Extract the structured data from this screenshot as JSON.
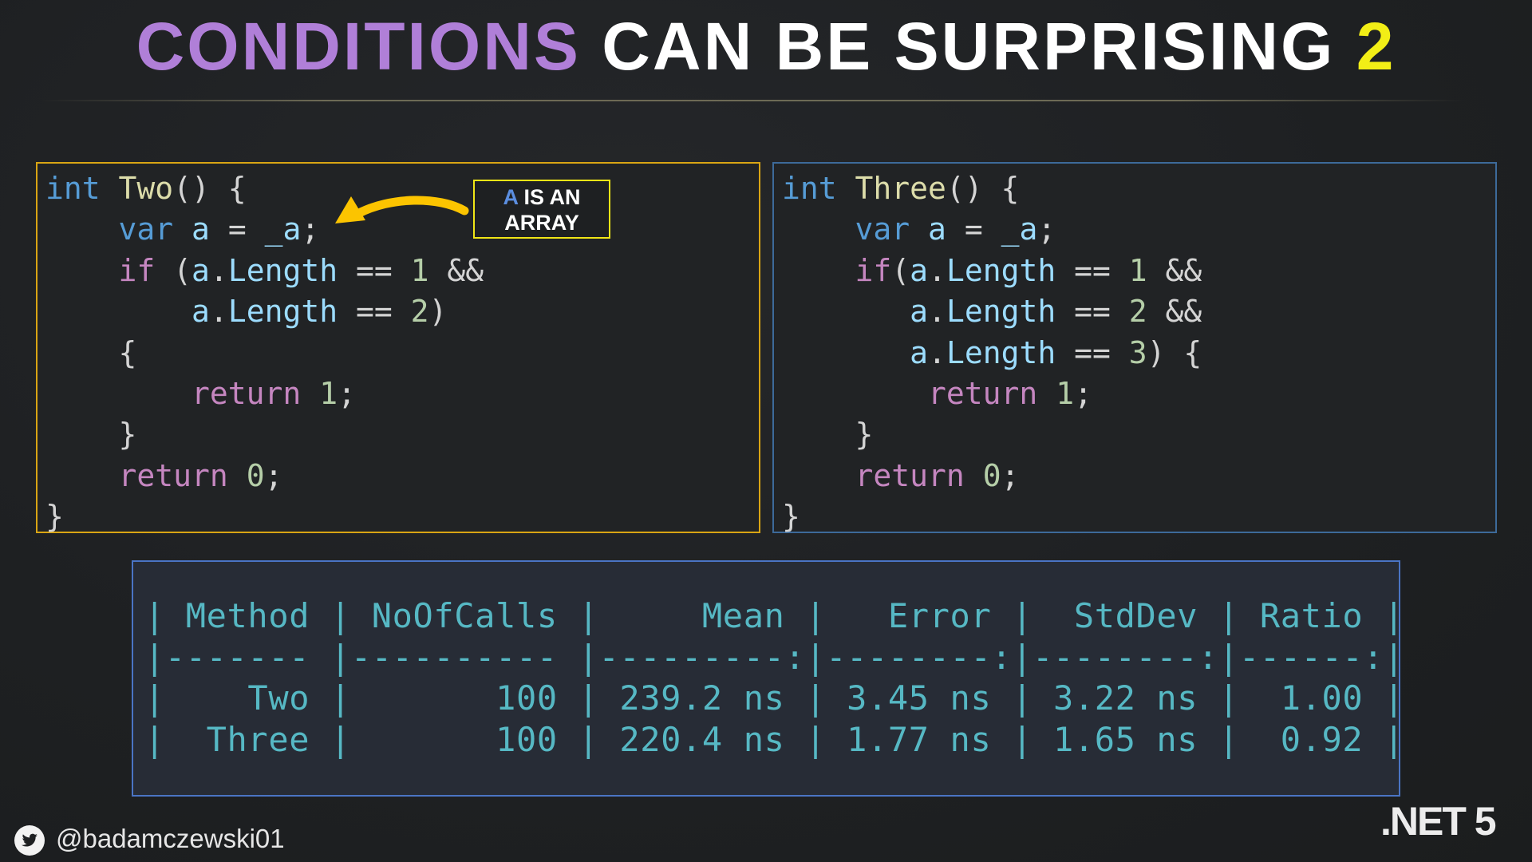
{
  "title": {
    "part1": "CONDITIONS",
    "part2": "CAN BE SURPRISING",
    "part3": "2",
    "colors": {
      "part1": "#b07fd8",
      "part2": "#ffffff",
      "part3": "#f2ee16"
    }
  },
  "code_colors": {
    "kw": "#569cd6",
    "fn": "#dcdcaa",
    "ctl": "#c586c0",
    "id": "#9cdcfe",
    "num": "#b5cea8",
    "p": "#d4d4d4"
  },
  "left_code": [
    [
      [
        "kw",
        "int"
      ],
      [
        "p",
        " "
      ],
      [
        "fn",
        "Two"
      ],
      [
        "p",
        "() {"
      ]
    ],
    [
      [
        "p",
        "    "
      ],
      [
        "kw",
        "var"
      ],
      [
        "p",
        " "
      ],
      [
        "id",
        "a"
      ],
      [
        "p",
        " = "
      ],
      [
        "id",
        "_a"
      ],
      [
        "p",
        ";"
      ]
    ],
    [
      [
        "p",
        "    "
      ],
      [
        "ctl",
        "if"
      ],
      [
        "p",
        " ("
      ],
      [
        "id",
        "a"
      ],
      [
        "p",
        "."
      ],
      [
        "id",
        "Length"
      ],
      [
        "p",
        " == "
      ],
      [
        "num",
        "1"
      ],
      [
        "p",
        " &&"
      ]
    ],
    [
      [
        "p",
        "        "
      ],
      [
        "id",
        "a"
      ],
      [
        "p",
        "."
      ],
      [
        "id",
        "Length"
      ],
      [
        "p",
        " == "
      ],
      [
        "num",
        "2"
      ],
      [
        "p",
        ")"
      ]
    ],
    [
      [
        "p",
        "    {"
      ]
    ],
    [
      [
        "p",
        "        "
      ],
      [
        "ctl",
        "return"
      ],
      [
        "p",
        " "
      ],
      [
        "num",
        "1"
      ],
      [
        "p",
        ";"
      ]
    ],
    [
      [
        "p",
        "    }"
      ]
    ],
    [
      [
        "p",
        "    "
      ],
      [
        "ctl",
        "return"
      ],
      [
        "p",
        " "
      ],
      [
        "num",
        "0"
      ],
      [
        "p",
        ";"
      ]
    ],
    [
      [
        "p",
        "}"
      ]
    ]
  ],
  "right_code": [
    [
      [
        "kw",
        "int"
      ],
      [
        "p",
        " "
      ],
      [
        "fn",
        "Three"
      ],
      [
        "p",
        "() {"
      ]
    ],
    [
      [
        "p",
        "    "
      ],
      [
        "kw",
        "var"
      ],
      [
        "p",
        " "
      ],
      [
        "id",
        "a"
      ],
      [
        "p",
        " = "
      ],
      [
        "id",
        "_a"
      ],
      [
        "p",
        ";"
      ]
    ],
    [
      [
        "p",
        "    "
      ],
      [
        "ctl",
        "if"
      ],
      [
        "p",
        "("
      ],
      [
        "id",
        "a"
      ],
      [
        "p",
        "."
      ],
      [
        "id",
        "Length"
      ],
      [
        "p",
        " == "
      ],
      [
        "num",
        "1"
      ],
      [
        "p",
        " &&"
      ]
    ],
    [
      [
        "p",
        "       "
      ],
      [
        "id",
        "a"
      ],
      [
        "p",
        "."
      ],
      [
        "id",
        "Length"
      ],
      [
        "p",
        " == "
      ],
      [
        "num",
        "2"
      ],
      [
        "p",
        " &&"
      ]
    ],
    [
      [
        "p",
        "       "
      ],
      [
        "id",
        "a"
      ],
      [
        "p",
        "."
      ],
      [
        "id",
        "Length"
      ],
      [
        "p",
        " == "
      ],
      [
        "num",
        "3"
      ],
      [
        "p",
        ") {"
      ]
    ],
    [
      [
        "p",
        "        "
      ],
      [
        "ctl",
        "return"
      ],
      [
        "p",
        " "
      ],
      [
        "num",
        "1"
      ],
      [
        "p",
        ";"
      ]
    ],
    [
      [
        "p",
        "    }"
      ]
    ],
    [
      [
        "p",
        "    "
      ],
      [
        "ctl",
        "return"
      ],
      [
        "p",
        " "
      ],
      [
        "num",
        "0"
      ],
      [
        "p",
        ";"
      ]
    ],
    [
      [
        "p",
        "}"
      ]
    ]
  ],
  "callout": {
    "highlight": "A",
    "line1_rest": " IS AN",
    "line2": "ARRAY"
  },
  "benchmark": {
    "lines": [
      "| Method | NoOfCalls |     Mean |   Error |  StdDev | Ratio |",
      "|------- |---------- |---------:|--------:|--------:|------:|",
      "|    Two |       100 | 239.2 ns | 3.45 ns | 3.22 ns |  1.00 |",
      "|  Three |       100 | 220.4 ns | 1.77 ns | 1.65 ns |  0.92 |"
    ]
  },
  "footer": {
    "handle": "@badamczewski01",
    "icon": "twitter-icon",
    "platform": ".NET 5"
  }
}
